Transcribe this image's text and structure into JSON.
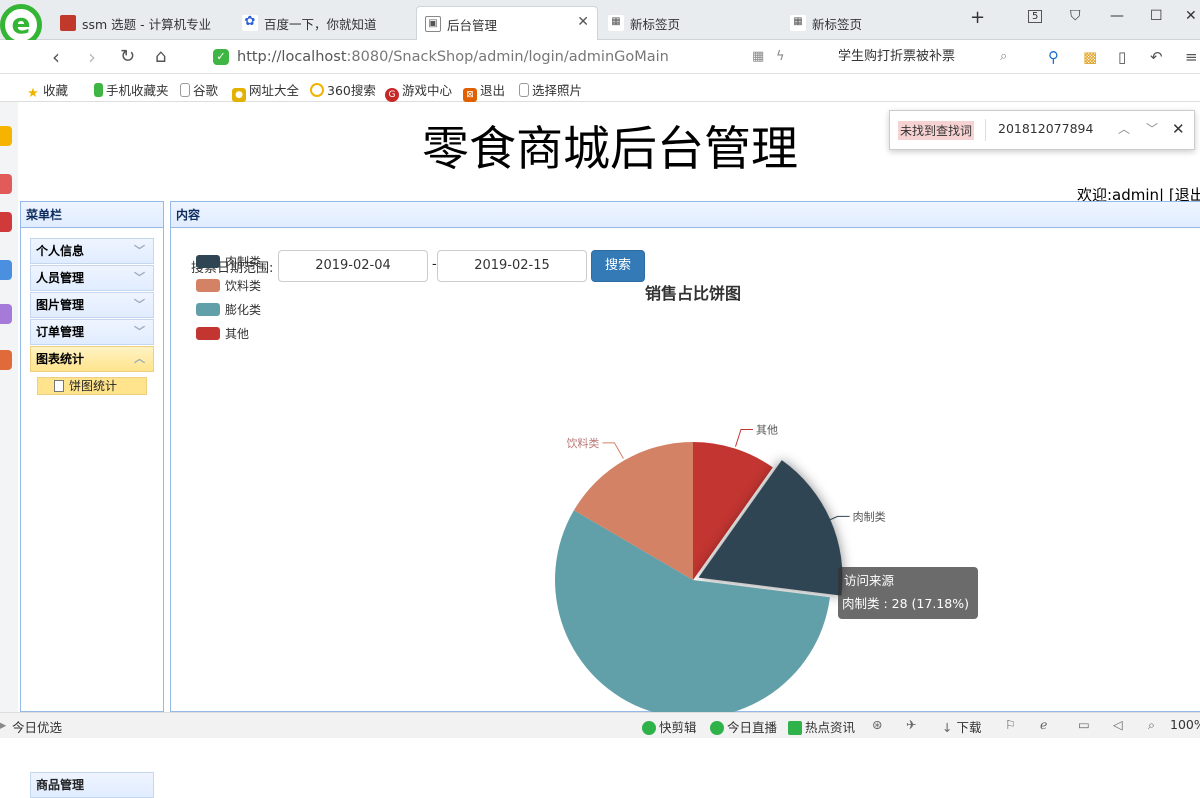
{
  "browser": {
    "tabs": [
      {
        "label": "ssm 选题 - 计算机专业",
        "icon": "page-icon"
      },
      {
        "label": "百度一下，你就知道",
        "icon": "baidu-paw-icon"
      },
      {
        "label": "后台管理",
        "icon": "image-icon",
        "active": true
      },
      {
        "label": "新标签页",
        "icon": "grid-icon"
      },
      {
        "label": "新标签页",
        "icon": "grid-icon"
      }
    ],
    "tab_count": "5",
    "url_host": "http://localhost",
    "url_rest": ":8080/SnackShop/admin/login/adminGoMain",
    "search_text": "学生购打折票被补票",
    "bookmarks": [
      "收藏",
      "手机收藏夹",
      "谷歌",
      "网址大全",
      "360搜索",
      "游戏中心",
      "退出",
      "选择照片"
    ]
  },
  "find": {
    "not_found": "未找到查找词",
    "term": "201812077894"
  },
  "header": {
    "title": "零食商城后台管理",
    "welcome": "欢迎:admin| [退出"
  },
  "sidebar": {
    "title": "菜单栏",
    "items": [
      {
        "label": "个人信息"
      },
      {
        "label": "人员管理"
      },
      {
        "label": "图片管理"
      },
      {
        "label": "订单管理"
      },
      {
        "label": "图表统计",
        "selected": true
      }
    ],
    "sub_item": "饼图统计",
    "bottom_item": "商品管理"
  },
  "content": {
    "panel_title": "内容",
    "search_label": "搜索日期范围:",
    "date_from": "2019-02-04",
    "date_separator": "-",
    "date_to": "2019-02-15",
    "search_button": "搜索"
  },
  "chart_data": {
    "type": "pie",
    "title": "销售占比饼图",
    "series_name": "访问来源",
    "categories": [
      "肉制类",
      "饮料类",
      "膨化类",
      "其他"
    ],
    "values": [
      28,
      27,
      92,
      16
    ],
    "colors": [
      "#2f4554",
      "#d48265",
      "#61a0a8",
      "#c23531"
    ],
    "legend_position": "top-left",
    "tooltip": {
      "series": "访问来源",
      "text": "肉制类 : 28 (17.18%)"
    }
  },
  "statusbar": {
    "left": "今日优选",
    "items": [
      "快剪辑",
      "今日直播",
      "热点资讯",
      "下载",
      "100%"
    ]
  }
}
